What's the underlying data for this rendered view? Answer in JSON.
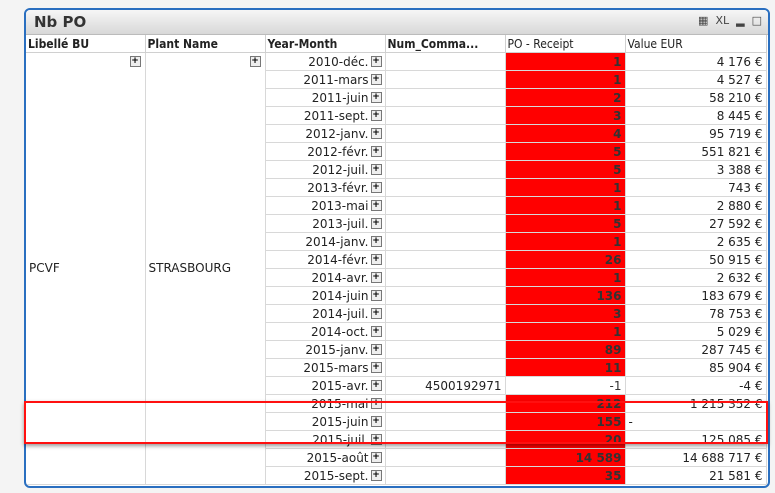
{
  "window": {
    "title": "Nb PO",
    "icons": [
      "print-icon",
      "excel-icon",
      "minimize-icon",
      "maximize-icon"
    ],
    "xl_label": "XL"
  },
  "columns": [
    "Libellé BU",
    "Plant Name",
    "Year-Month",
    "Num_Comma...",
    "PO - Receipt",
    "Value EUR"
  ],
  "libelle_bu": "PCVF",
  "plant_name": "STRASBOURG",
  "colors": {
    "highlight": "#ff0000",
    "border": "#2a6fc0",
    "annotation_box": "#ff1010"
  },
  "rows": [
    {
      "ym": "2010-déc.",
      "num": "",
      "po": "1",
      "val": "4 176 €"
    },
    {
      "ym": "2011-mars",
      "num": "",
      "po": "1",
      "val": "4 527 €"
    },
    {
      "ym": "2011-juin",
      "num": "",
      "po": "2",
      "val": "58 210 €"
    },
    {
      "ym": "2011-sept.",
      "num": "",
      "po": "3",
      "val": "8 445 €"
    },
    {
      "ym": "2012-janv.",
      "num": "",
      "po": "4",
      "val": "95 719 €"
    },
    {
      "ym": "2012-févr.",
      "num": "",
      "po": "5",
      "val": "551 821 €"
    },
    {
      "ym": "2012-juil.",
      "num": "",
      "po": "5",
      "val": "3 388 €"
    },
    {
      "ym": "2013-févr.",
      "num": "",
      "po": "1",
      "val": "743 €"
    },
    {
      "ym": "2013-mai",
      "num": "",
      "po": "1",
      "val": "2 880 €"
    },
    {
      "ym": "2013-juil.",
      "num": "",
      "po": "5",
      "val": "27 592 €"
    },
    {
      "ym": "2014-janv.",
      "num": "",
      "po": "1",
      "val": "2 635 €"
    },
    {
      "ym": "2014-févr.",
      "num": "",
      "po": "26",
      "val": "50 915 €"
    },
    {
      "ym": "2014-avr.",
      "num": "",
      "po": "1",
      "val": "2 632 €"
    },
    {
      "ym": "2014-juin",
      "num": "",
      "po": "136",
      "val": "183 679 €"
    },
    {
      "ym": "2014-juil.",
      "num": "",
      "po": "3",
      "val": "78 753 €"
    },
    {
      "ym": "2014-oct.",
      "num": "",
      "po": "1",
      "val": "5 029 €"
    },
    {
      "ym": "2015-janv.",
      "num": "",
      "po": "89",
      "val": "287 745 €"
    },
    {
      "ym": "2015-mars",
      "num": "",
      "po": "11",
      "val": "85 904 €"
    },
    {
      "ym": "2015-avr.",
      "num": "4500192971",
      "po": "-1",
      "val": "-4 €",
      "plain": true
    },
    {
      "ym": "2015-mai",
      "num": "",
      "po": "212",
      "val": "1 215 352 €"
    },
    {
      "ym": "2015-juin",
      "num": "",
      "po": "155",
      "val": "-",
      "leftval": true
    },
    {
      "ym": "2015-juil.",
      "num": "",
      "po": "20",
      "val": "125 085 €"
    },
    {
      "ym": "2015-août",
      "num": "",
      "po": "14 589",
      "val": "14 688 717 €"
    },
    {
      "ym": "2015-sept.",
      "num": "",
      "po": "35",
      "val": "21 581 €"
    }
  ]
}
